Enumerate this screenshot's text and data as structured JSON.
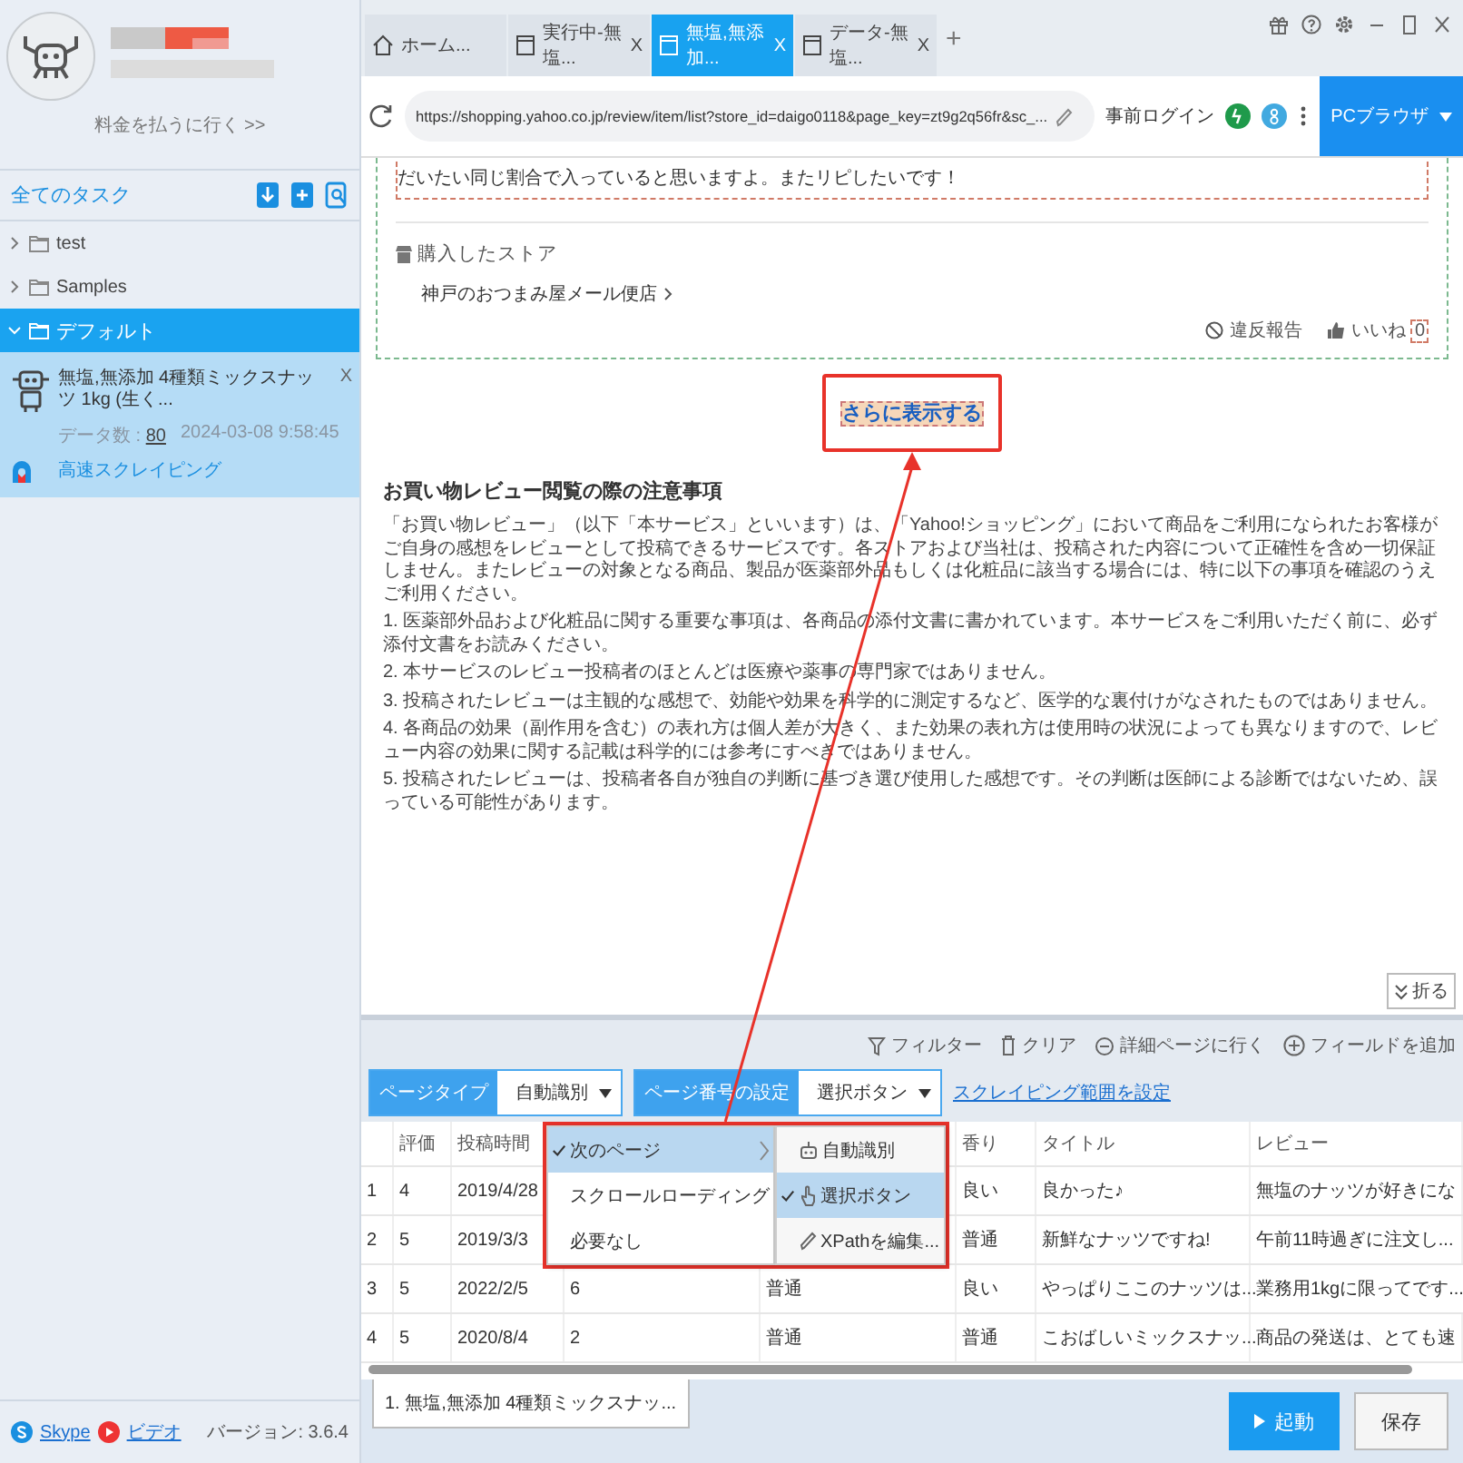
{
  "sidebar": {
    "pay_link": "料金を払うに行く >>",
    "section_title": "全てのタスク",
    "tree": [
      {
        "label": "test",
        "expanded": false,
        "selected": false
      },
      {
        "label": "Samples",
        "expanded": false,
        "selected": false
      },
      {
        "label": "デフォルト",
        "expanded": true,
        "selected": true,
        "tasks": [
          {
            "title": "無塩,無添加 4種類ミックスナッツ 1kg (生く...",
            "close": "X",
            "count_label": "データ数 :",
            "count": "80",
            "date": "2024-03-08 9:58:45",
            "mode": "高速スクレイピング"
          }
        ]
      }
    ],
    "footer": {
      "skype": "Skype",
      "video": "ビデオ",
      "version": "バージョン: 3.6.4"
    }
  },
  "browser": {
    "tabs": [
      {
        "kind": "home",
        "label": "ホーム...",
        "selected": false
      },
      {
        "kind": "page",
        "label": "実行中-無塩...",
        "close": "X",
        "selected": false
      },
      {
        "kind": "page",
        "label": "無塩,無添加...",
        "close": "X",
        "selected": true
      },
      {
        "kind": "page",
        "label": "データ-無塩...",
        "close": "X",
        "selected": false
      }
    ],
    "new_tab": "+",
    "url": "https://shopping.yahoo.co.jp/review/item/list?store_id=daigo0118&page_key=zt9g2q56fr&sc_...",
    "pre_login": "事前ログイン",
    "browser_mode": "PCブラウザ"
  },
  "page": {
    "review_text": "だいたい同じ割合で入っていると思いますよ。またリピしたいです！",
    "store_label": "購入したストア",
    "store_name": "神戸のおつまみ屋メール便店",
    "report": "違反報告",
    "like": "いいね",
    "like_count": "0",
    "show_more": "さらに表示する",
    "notice_title": "お買い物レビュー閲覧の際の注意事項",
    "notice_intro": "「お買い物レビュー」（以下「本サービス」といいます）は、「Yahoo!ショッピング」において商品をご利用になられたお客様がご自身の感想をレビューとして投稿できるサービスです。各ストアおよび当社は、投稿された内容について正確性を含め一切保証しません。またレビューの対象となる商品、製品が医薬部外品もしくは化粧品に該当する場合には、特に以下の事項を確認のうえご利用ください。",
    "notice_items": [
      "1. 医薬部外品および化粧品に関する重要な事項は、各商品の添付文書に書かれています。本サービスをご利用いただく前に、必ず添付文書をお読みください。",
      "2. 本サービスのレビュー投稿者のほとんどは医療や薬事の専門家ではありません。",
      "3. 投稿されたレビューは主観的な感想で、効能や効果を科学的に測定するなど、医学的な裏付けがなされたものではありません。",
      "4. 各商品の効果（副作用を含む）の表れ方は個人差が大きく、また効果の表れ方は使用時の状況によっても異なりますので、レビュー内容の効果に関する記載は科学的には参考にすべきではありません。",
      "5. 投稿されたレビューは、投稿者各自が独自の判断に基づき選び使用した感想です。その判断は医師による診断ではないため、誤っている可能性があります。"
    ],
    "collapse": "折る"
  },
  "toolbar": {
    "page_type_label": "ページタイプ",
    "page_type_value": "自動識別",
    "pagination_label": "ページ番号の設定",
    "pagination_value": "選択ボタン",
    "range_link": "スクレイピング範囲を設定",
    "tools": [
      {
        "kind": "filter",
        "label": "フィルター"
      },
      {
        "kind": "clear",
        "label": "クリア"
      },
      {
        "kind": "detail",
        "label": "詳細ページに行く"
      },
      {
        "kind": "add",
        "label": "フィールドを追加"
      }
    ]
  },
  "pagination_menu": {
    "items": [
      {
        "label": "次のページ",
        "checked": true,
        "selected": true,
        "submenu": true
      },
      {
        "label": "スクロールローディング",
        "checked": false,
        "selected": false,
        "submenu": false
      },
      {
        "label": "必要なし",
        "checked": false,
        "selected": false,
        "submenu": false
      }
    ],
    "submenu": [
      {
        "kind": "auto",
        "label": "自動識別",
        "checked": false,
        "selected": false
      },
      {
        "kind": "select",
        "label": "選択ボタン",
        "checked": true,
        "selected": true
      },
      {
        "kind": "xpath",
        "label": "XPathを編集...",
        "checked": false,
        "selected": false
      }
    ]
  },
  "table": {
    "columns": {
      "rating": "評価",
      "posted": "投稿時間",
      "aroma": "香り",
      "title": "タイトル",
      "review": "レビュー"
    },
    "rows": [
      {
        "number": "1",
        "rating": "4",
        "posted": "2019/4/28",
        "aroma": "良い",
        "title": "良かった♪",
        "review": "無塩のナッツが好きにな"
      },
      {
        "number": "2",
        "rating": "5",
        "posted": "2019/3/3",
        "aroma": "普通",
        "title": "新鮮なナッツですね!",
        "review": "午前11時過ぎに注文し..."
      },
      {
        "number": "3",
        "rating": "5",
        "posted": "2022/2/5",
        "column_4": "6",
        "column_5": "普通",
        "aroma": "良い",
        "title": "やっぱりここのナッツは...",
        "review": "業務用1kgに限ってです..."
      },
      {
        "number": "4",
        "rating": "5",
        "posted": "2020/8/4",
        "column_4": "2",
        "column_5": "普通",
        "aroma": "普通",
        "title": "こおばしいミックスナッ...",
        "review": "商品の発送は、とても速"
      }
    ]
  },
  "bottom": {
    "task_tab": "1. 無塩,無添加 4種類ミックスナッ...",
    "run": "起動",
    "save": "保存"
  }
}
